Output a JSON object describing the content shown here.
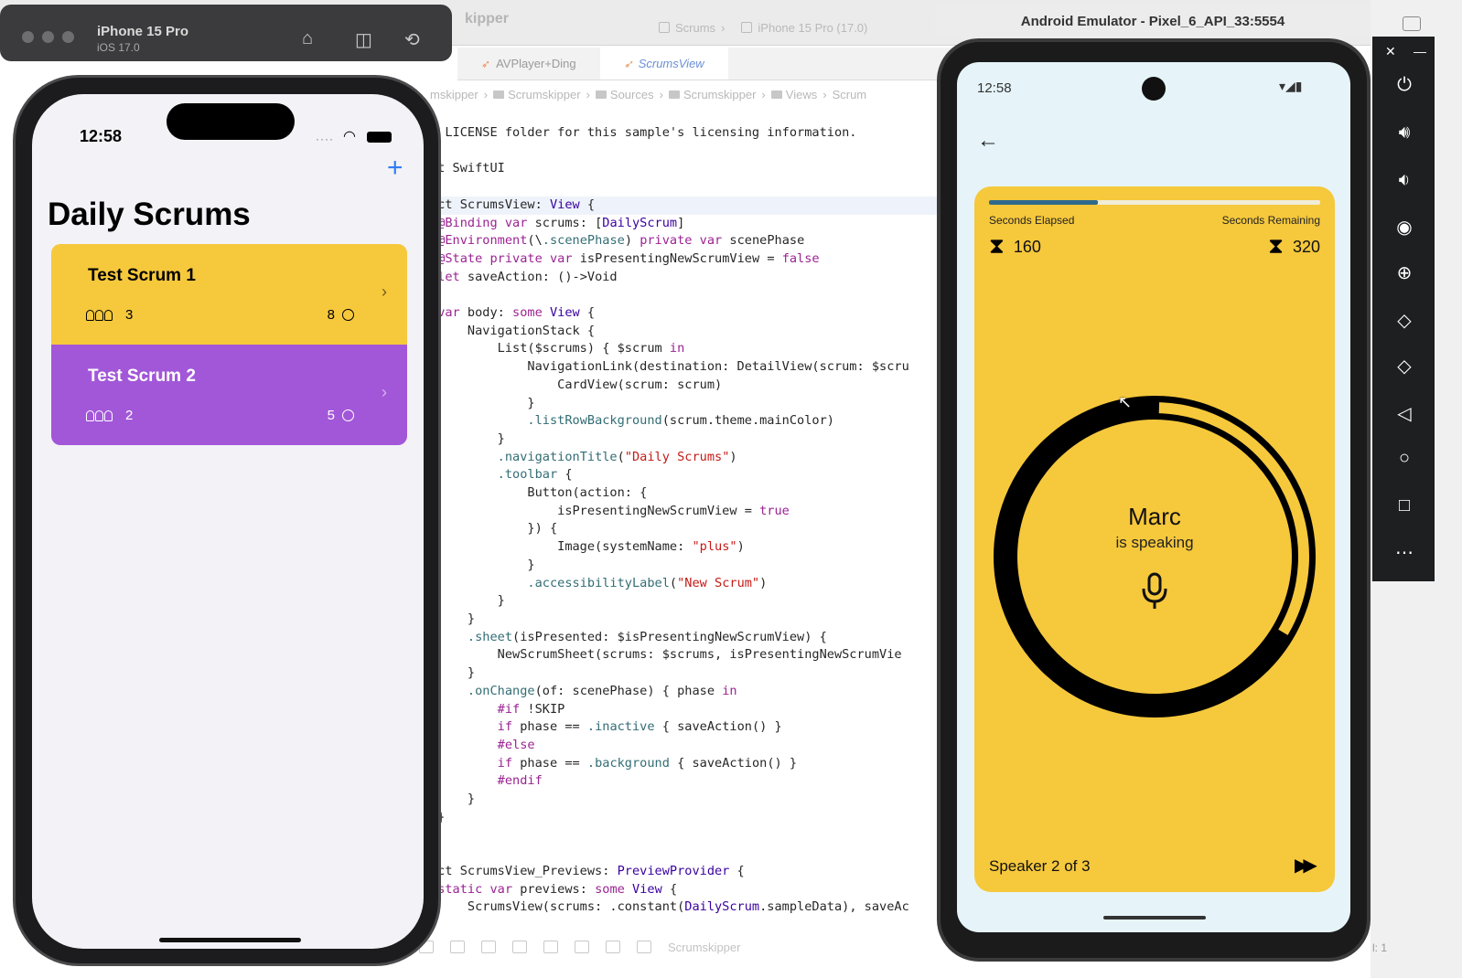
{
  "xcode": {
    "window_title": "kipper",
    "scheme": [
      "Scrums",
      "iPhone 15 Pro (17.0)"
    ],
    "tabs": [
      {
        "label": "AVPlayer+Ding",
        "active": false
      },
      {
        "label": "ScrumsView",
        "active": true
      }
    ],
    "breadcrumbs": [
      "mskipper",
      "Scrumskipper",
      "Sources",
      "Scrumskipper",
      "Views",
      "Scrum"
    ],
    "bottom_target": "Scrumskipper",
    "status_right": "l: 1"
  },
  "code_lines": [
    "e LICENSE folder for this sample's licensing information.",
    "",
    "rt SwiftUI",
    "",
    "uct ScrumsView: View {",
    " @Binding var scrums: [DailyScrum]",
    " @Environment(\\.scenePhase) private var scenePhase",
    " @State private var isPresentingNewScrumView = false",
    " let saveAction: ()->Void",
    "",
    " var body: some View {",
    "     NavigationStack {",
    "         List($scrums) { $scrum in",
    "             NavigationLink(destination: DetailView(scrum: $scru",
    "                 CardView(scrum: scrum)",
    "             }",
    "             .listRowBackground(scrum.theme.mainColor)",
    "         }",
    "         .navigationTitle(\"Daily Scrums\")",
    "         .toolbar {",
    "             Button(action: {",
    "                 isPresentingNewScrumView = true",
    "             }) {",
    "                 Image(systemName: \"plus\")",
    "             }",
    "             .accessibilityLabel(\"New Scrum\")",
    "         }",
    "     }",
    "     .sheet(isPresented: $isPresentingNewScrumView) {",
    "         NewScrumSheet(scrums: $scrums, isPresentingNewScrumVie",
    "     }",
    "     .onChange(of: scenePhase) { phase in",
    "         #if !SKIP",
    "         if phase == .inactive { saveAction() }",
    "         #else",
    "         if phase == .background { saveAction() }",
    "         #endif",
    "     }",
    " }",
    "",
    "",
    "uct ScrumsView_Previews: PreviewProvider {",
    " static var previews: some View {",
    "     ScrumsView(scrums: .constant(DailyScrum.sampleData), saveAc"
  ],
  "ios_sim": {
    "device_name": "iPhone 15 Pro",
    "os_version": "iOS 17.0",
    "status_time": "12:58",
    "nav_title": "Daily Scrums",
    "add_button": "+",
    "scrums": [
      {
        "title": "Test Scrum 1",
        "attendees": "3",
        "length": "8",
        "color": "#f6c83c"
      },
      {
        "title": "Test Scrum 2",
        "attendees": "2",
        "length": "5",
        "color": "#a257d8"
      }
    ]
  },
  "android_emu": {
    "window_title": "Android Emulator - Pixel_6_API_33:5554",
    "status_time": "12:58",
    "meeting": {
      "elapsed_label": "Seconds Elapsed",
      "elapsed_value": "160",
      "remaining_label": "Seconds Remaining",
      "remaining_value": "320",
      "progress_fraction": 0.33,
      "ring_fraction": 0.33,
      "speaker_name": "Marc",
      "speaker_status": "is speaking",
      "footer": "Speaker 2 of 3",
      "theme_color": "#f6c83c",
      "progress_color": "#2e6a8a"
    }
  }
}
